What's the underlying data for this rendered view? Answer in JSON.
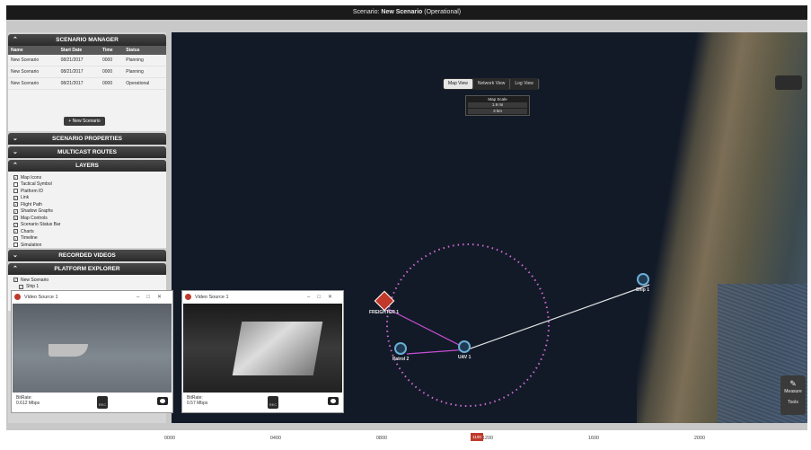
{
  "titlebar": {
    "prefix": "Scenario:",
    "name": "New Scenario",
    "state": "(Operational)"
  },
  "scenario_manager": {
    "header": "SCENARIO MANAGER",
    "columns": [
      "Name",
      "Start Date",
      "Time",
      "Status"
    ],
    "rows": [
      [
        "New Scenario",
        "08/21/2017",
        "0000",
        "Planning"
      ],
      [
        "New Scenario",
        "08/21/2017",
        "0000",
        "Planning"
      ],
      [
        "New Scenario",
        "08/21/2017",
        "0000",
        "Operational"
      ]
    ],
    "new_button": "+ New Scenario"
  },
  "sections": {
    "properties": "SCENARIO PROPERTIES",
    "multicast": "MULTICAST ROUTES",
    "layers": "LAYERS",
    "videos": "RECORDED VIDEOS",
    "explorer": "PLATFORM EXPLORER"
  },
  "layers": [
    {
      "label": "Map Icons",
      "checked": true
    },
    {
      "label": "Tactical Symbol",
      "checked": false
    },
    {
      "label": "Platform ID",
      "checked": false
    },
    {
      "label": "Link",
      "checked": true
    },
    {
      "label": "Flight Path",
      "checked": true
    },
    {
      "label": "Shadow Graphs",
      "checked": true
    },
    {
      "label": "Map Controls",
      "checked": true
    },
    {
      "label": "Scenario Status Bar",
      "checked": true
    },
    {
      "label": "Charts",
      "checked": true
    },
    {
      "label": "Timeline",
      "checked": true
    },
    {
      "label": "Simulation",
      "checked": false
    }
  ],
  "explorer": {
    "root": "New Scenario",
    "child": "Ship 1"
  },
  "map": {
    "tabs": [
      "Map View",
      "Network View",
      "Log View"
    ],
    "scale_title": "Map Scale",
    "scale_rows": [
      "1.9 mi",
      "3 km"
    ],
    "targets": {
      "freighter": "FREIGHTER 1",
      "ship": "Ship 1",
      "patrol": "Patrol 2",
      "uav": "UAV 1"
    },
    "tools_label": "Tools",
    "measure_label": "Measure"
  },
  "videos": [
    {
      "title": "Video Source 1",
      "bitrate_label": "BitRate:",
      "bitrate": "0.612 Mbps",
      "rec_label": "REC"
    },
    {
      "title": "Video Source 1",
      "bitrate_label": "BitRate:",
      "bitrate": "0.57 Mbps",
      "rec_label": "REC"
    }
  ],
  "timeline": {
    "ticks": [
      "0000",
      "0400",
      "0800",
      "1200",
      "1600",
      "2000"
    ],
    "current": "1100"
  }
}
